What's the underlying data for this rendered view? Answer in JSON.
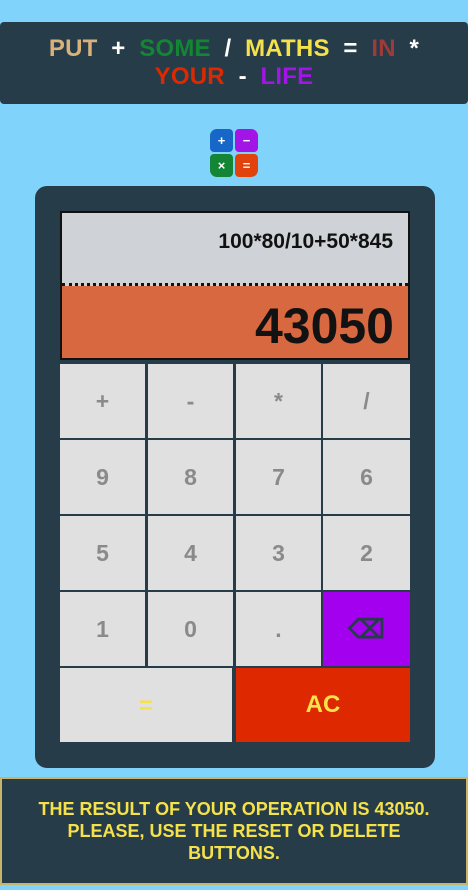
{
  "banner": {
    "line1": [
      {
        "text": "PUT",
        "color": "#d9b27b"
      },
      {
        "text": "+",
        "color": "#ffffff"
      },
      {
        "text": "SOME",
        "color": "#138534"
      },
      {
        "text": "/",
        "color": "#ffffff"
      },
      {
        "text": "MATHS",
        "color": "#f5e14a"
      },
      {
        "text": "=",
        "color": "#ffffff"
      },
      {
        "text": "IN",
        "color": "#9e3a3a"
      },
      {
        "text": "*",
        "color": "#ffffff"
      }
    ],
    "line2": [
      {
        "text": "YOUR",
        "color": "#de2900"
      },
      {
        "text": "-",
        "color": "#ffffff"
      },
      {
        "text": "LIFE",
        "color": "#a314e6"
      }
    ]
  },
  "logo": {
    "icons": [
      "plus-icon",
      "minus-icon",
      "times-icon",
      "equals-icon"
    ],
    "glyphs": [
      "+",
      "−",
      "×",
      "="
    ]
  },
  "display": {
    "expression": "100*80/10+50*845",
    "result": "43050"
  },
  "keys": {
    "plus": "+",
    "minus": "-",
    "multiply": "*",
    "divide": "/",
    "nine": "9",
    "eight": "8",
    "seven": "7",
    "six": "6",
    "five": "5",
    "four": "4",
    "three": "3",
    "two": "2",
    "one": "1",
    "zero": "0",
    "dot": ".",
    "backspace": "⌫",
    "equals": "=",
    "clear": "AC"
  },
  "message": "THE RESULT OF YOUR OPERATION IS 43050. PLEASE, USE THE RESET OR DELETE BUTTONS.",
  "colors": {
    "page_bg": "#80d4fb",
    "panel_bg": "#263c48",
    "result_bg": "#d7683f",
    "delete_bg": "#a300f0",
    "clear_bg": "#de2900",
    "accent_text": "#f5e14a"
  }
}
